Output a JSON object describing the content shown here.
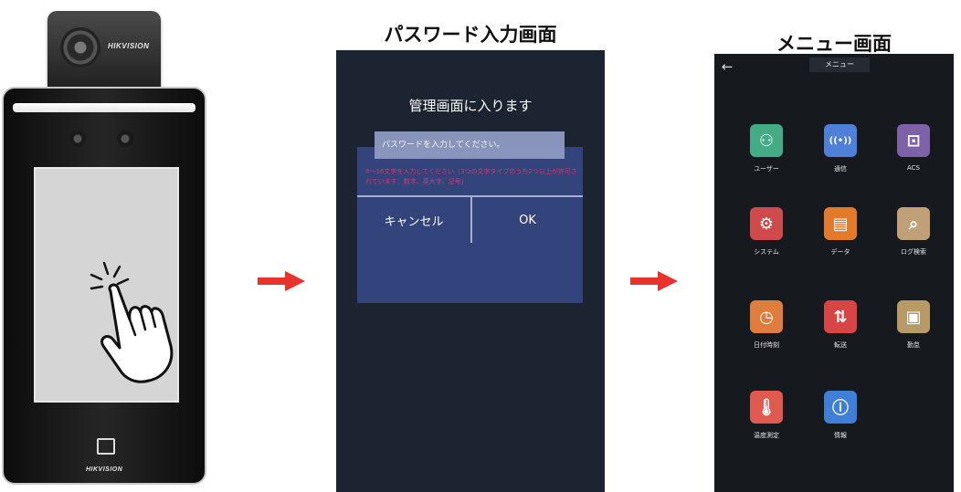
{
  "device": {
    "brand_top": "HIKVISION",
    "brand_bottom": "HIKVISION"
  },
  "password_screen": {
    "title": "パスワード入力画面",
    "heading": "管理画面に入ります",
    "input_placeholder": "パスワードを入力してください。",
    "error_text": "8～16文字を入力してください（3つの文字タイプのうち2つ以上が許可されています：数字、英大字、記号）",
    "cancel_label": "キャンセル",
    "ok_label": "OK"
  },
  "menu_screen": {
    "title": "メニュー画面",
    "header_title": "メニュー",
    "back_glyph": "←",
    "items": [
      {
        "label": "ユーザー",
        "icon": "user-icon",
        "glyph": "⚇",
        "color": "#43ab86"
      },
      {
        "label": "通信",
        "icon": "communication-icon",
        "glyph": "((•))",
        "color": "#4e7fd9"
      },
      {
        "label": "ACS",
        "icon": "access-control-icon",
        "glyph": "⊡",
        "color": "#7e62a8"
      },
      {
        "label": "システム",
        "icon": "system-icon",
        "glyph": "⚙",
        "color": "#cf4b4b"
      },
      {
        "label": "データ",
        "icon": "data-icon",
        "glyph": "▤",
        "color": "#e17b2b"
      },
      {
        "label": "ログ検索",
        "icon": "log-search-icon",
        "glyph": "⌕",
        "color": "#bfa077"
      },
      {
        "label": "日付時刻",
        "icon": "clock-icon",
        "glyph": "◷",
        "color": "#e07c3c"
      },
      {
        "label": "転送",
        "icon": "transfer-icon",
        "glyph": "⇅",
        "color": "#d94545"
      },
      {
        "label": "勤怠",
        "icon": "attendance-icon",
        "glyph": "▣",
        "color": "#b89b64"
      },
      {
        "label": "温度測定",
        "icon": "thermometer-icon",
        "glyph": "🌡",
        "color": "#e05a4f"
      },
      {
        "label": "情報",
        "icon": "info-icon",
        "glyph": "ⓘ",
        "color": "#3f7fd8"
      }
    ]
  },
  "colors": {
    "arrow": "#e8322e",
    "dialog": "#33437c",
    "error": "#e0306b"
  }
}
